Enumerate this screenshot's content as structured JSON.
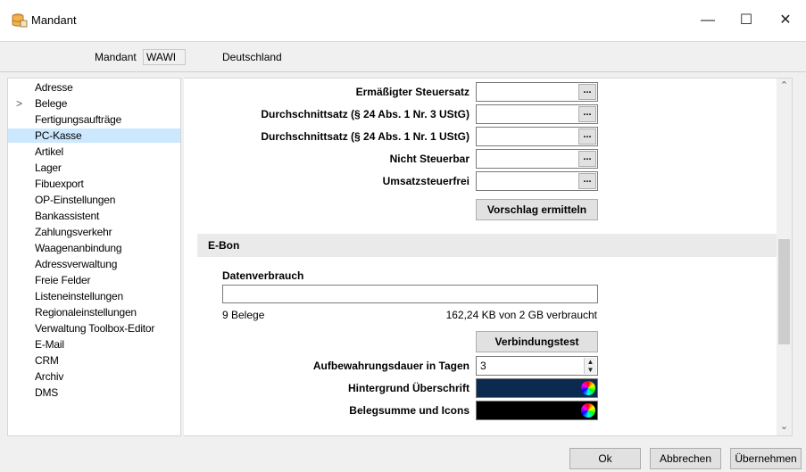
{
  "window": {
    "title": "Mandant",
    "min_glyph": "—",
    "max_glyph": "☐",
    "close_glyph": "✕",
    "icon": "database-key-icon"
  },
  "header": {
    "label": "Mandant",
    "value": "WAWI",
    "country": "Deutschland"
  },
  "nav": {
    "items": [
      {
        "label": "Adresse"
      },
      {
        "label": "Belege",
        "expandable": true
      },
      {
        "label": "Fertigungsaufträge"
      },
      {
        "label": "PC-Kasse",
        "selected": true
      },
      {
        "label": "Artikel"
      },
      {
        "label": "Lager"
      },
      {
        "label": "Fibuexport"
      },
      {
        "label": "OP-Einstellungen"
      },
      {
        "label": "Bankassistent"
      },
      {
        "label": "Zahlungsverkehr"
      },
      {
        "label": "Waagenanbindung"
      },
      {
        "label": "Adressverwaltung"
      },
      {
        "label": "Freie Felder"
      },
      {
        "label": "Listeneinstellungen"
      },
      {
        "label": "Regionaleinstellungen"
      },
      {
        "label": "Verwaltung Toolbox-Editor"
      },
      {
        "label": "E-Mail"
      },
      {
        "label": "CRM"
      },
      {
        "label": "Archiv"
      },
      {
        "label": "DMS"
      }
    ],
    "chevron": ">"
  },
  "tax_rows": [
    {
      "label": "Ermäßigter Steuersatz",
      "button": "..."
    },
    {
      "label": "Durchschnittsatz (§ 24 Abs. 1 Nr. 3 UStG)",
      "button": "..."
    },
    {
      "label": "Durchschnittsatz (§ 24 Abs. 1 Nr. 1 UStG)",
      "button": "..."
    },
    {
      "label": "Nicht Steuerbar",
      "button": "..."
    },
    {
      "label": "Umsatzsteuerfrei",
      "button": "..."
    }
  ],
  "suggest_button": "Vorschlag ermitteln",
  "ebon": {
    "section_title": "E-Bon",
    "usage_label": "Datenverbrauch",
    "usage_fraction": 0.0001,
    "documents": "9 Belege",
    "usage_text": "162,24 KB von 2 GB verbraucht",
    "test_button": "Verbindungstest",
    "retention_label": "Aufbewahrungsdauer in Tagen",
    "retention_value": "3",
    "header_bg_label": "Hintergrund Überschrift",
    "header_bg_color": "#0a2a4f",
    "total_label": "Belegsumme und Icons",
    "total_color": "#000000"
  },
  "scroll": {
    "up": "⌃",
    "down": "⌄"
  },
  "footer": {
    "ok": "Ok",
    "cancel": "Abbrechen",
    "apply": "Übernehmen"
  }
}
